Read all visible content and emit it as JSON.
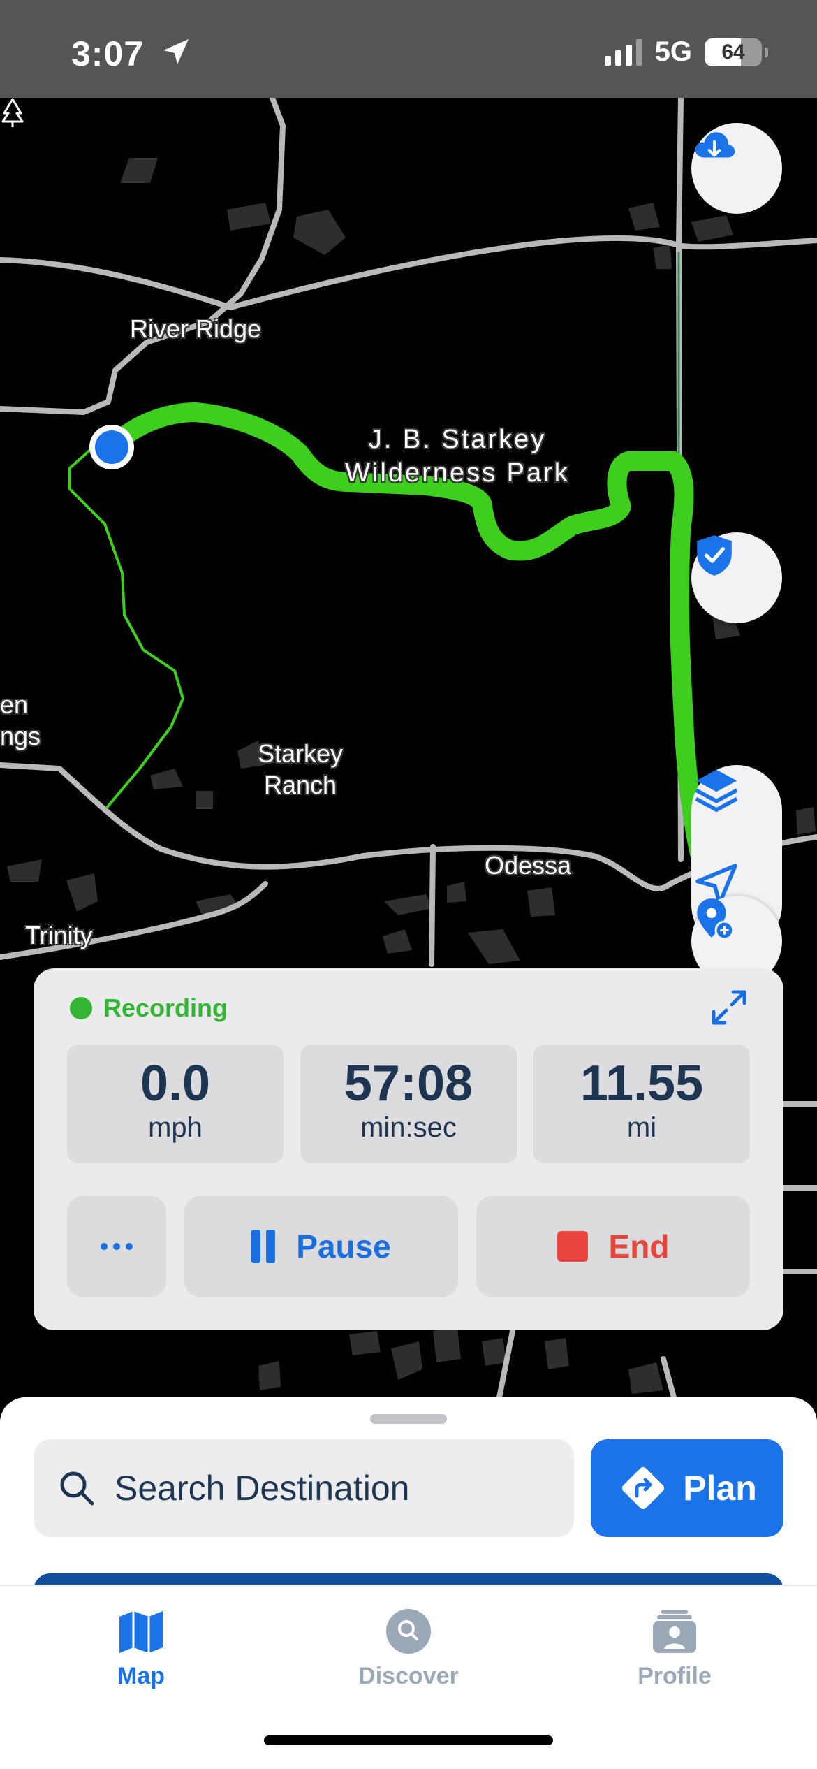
{
  "status_bar": {
    "time": "3:07",
    "network": "5G",
    "battery": "64",
    "battery_level": 0.64
  },
  "map": {
    "labels": {
      "river_ridge": "River Ridge",
      "park_line1": "J. B. Starkey",
      "park_line2": "Wilderness Park",
      "starkey_line1": "Starkey",
      "starkey_line2": "Ranch",
      "odessa": "Odessa",
      "trinity": "Trinity",
      "edge_line1": "en",
      "edge_line2": "ngs"
    },
    "buttons": {
      "download": "cloud-download-icon",
      "safety": "shield-check-icon",
      "layers": "layers-icon",
      "locate": "navigation-arrow-icon",
      "add_pin": "add-location-pin-icon"
    },
    "colors": {
      "route": "#3ecf1e",
      "accent": "#1a73e8"
    }
  },
  "recording": {
    "status": "Recording",
    "stats": [
      {
        "value": "0.0",
        "unit": "mph"
      },
      {
        "value": "57:08",
        "unit": "min:sec"
      },
      {
        "value": "11.55",
        "unit": "mi"
      }
    ],
    "pause_label": "Pause",
    "end_label": "End"
  },
  "search": {
    "placeholder": "Search Destination",
    "plan_label": "Plan"
  },
  "tabs": [
    {
      "label": "Map",
      "active": true
    },
    {
      "label": "Discover",
      "active": false
    },
    {
      "label": "Profile",
      "active": false
    }
  ]
}
